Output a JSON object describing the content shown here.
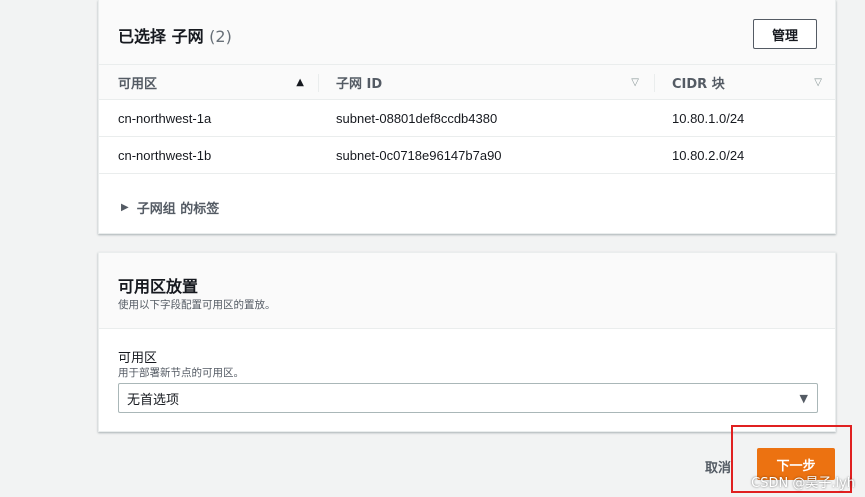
{
  "subnets_panel": {
    "title": "已选择 子网",
    "count": "(2)",
    "manage_button": "管理",
    "columns": [
      {
        "label": "可用区",
        "sort": "▲"
      },
      {
        "label": "子网 ID",
        "sort": "▽"
      },
      {
        "label": "CIDR 块",
        "sort": "▽"
      }
    ],
    "rows": [
      {
        "az": "cn-northwest-1a",
        "subnet_id": "subnet-08801def8ccdb4380",
        "cidr": "10.80.1.0/24"
      },
      {
        "az": "cn-northwest-1b",
        "subnet_id": "subnet-0c0718e96147b7a90",
        "cidr": "10.80.2.0/24"
      }
    ],
    "tags_expander": "子网组 的标签",
    "expander_icon": "caret-right-icon"
  },
  "placement_panel": {
    "title": "可用区放置",
    "description": "使用以下字段配置可用区的置放。",
    "field_label": "可用区",
    "field_description": "用于部署新节点的可用区。",
    "select_value": "无首选项",
    "select_icon": "caret-down-icon"
  },
  "footer": {
    "cancel_label": "取消",
    "next_label": "下一步"
  },
  "watermark": "CSDN @昊子.lyh",
  "colors": {
    "primary": "#ec7211",
    "highlight": "#e02020",
    "background": "#f2f3f3"
  }
}
